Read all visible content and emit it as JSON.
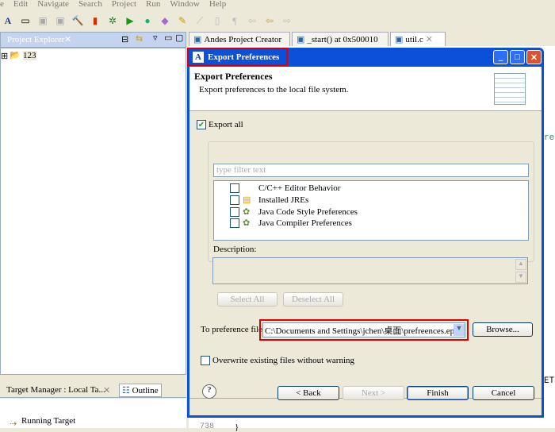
{
  "menu": [
    "e",
    "Edit",
    "Navigate",
    "Search",
    "Project",
    "Run",
    "Window",
    "Help"
  ],
  "left": {
    "tab": "Project Explorer",
    "tree_item": "123",
    "bottom_tab1": "Target Manager : Local Ta...",
    "bottom_tab2": "Outline",
    "bottom_item": "Running Target"
  },
  "editor": {
    "tabs": [
      "Andes Project Creator",
      "_start() at 0x500010",
      "util.c"
    ],
    "line_number": "738",
    "code_fragment_1": "re",
    "code_fragment_2": "ET",
    "code_brace": "}"
  },
  "dialog": {
    "title": "Export Preferences",
    "header_title": "Export Preferences",
    "header_desc": "Export preferences to the local file system.",
    "export_all": "Export all",
    "export_all_checked": true,
    "filter_placeholder": "type filter text",
    "items": [
      "C/C++ Editor Behavior",
      "Installed JREs",
      "Java Code Style Preferences",
      "Java Compiler Preferences"
    ],
    "description_label": "Description:",
    "select_all": "Select All",
    "deselect_all": "Deselect All",
    "file_label": "To preference file:",
    "file_value": "C:\\Documents and Settings\\jchen\\桌面\\prefreences.epf",
    "browse": "Browse...",
    "overwrite": "Overwrite existing files without warning",
    "overwrite_checked": false,
    "back": "< Back",
    "next": "Next >",
    "finish": "Finish",
    "cancel": "Cancel"
  },
  "colors": {
    "highlight": "#e00000",
    "titlebar": "#0a50d8"
  }
}
